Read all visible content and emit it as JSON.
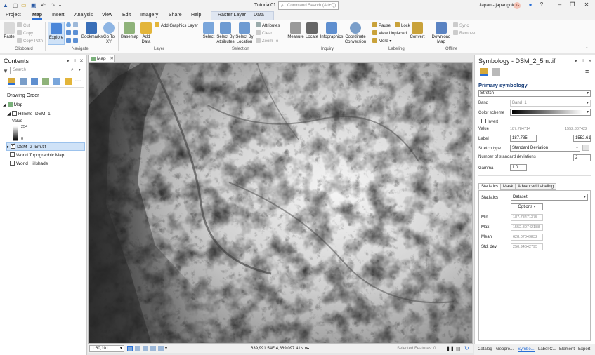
{
  "title_bar": {
    "doc_title": "Tutorial01",
    "search_placeholder": "Command Search (Alt+Q)",
    "account": "Japan - japangold",
    "avatar_initials": "JG",
    "help": "?"
  },
  "tabs": [
    {
      "label": "Project",
      "active": false
    },
    {
      "label": "Map",
      "active": true
    },
    {
      "label": "Insert",
      "active": false
    },
    {
      "label": "Analysis",
      "active": false
    },
    {
      "label": "View",
      "active": false
    },
    {
      "label": "Edit",
      "active": false
    },
    {
      "label": "Imagery",
      "active": false
    },
    {
      "label": "Share",
      "active": false
    },
    {
      "label": "Help",
      "active": false
    },
    {
      "label": "Raster Layer",
      "active": false
    },
    {
      "label": "Data",
      "active": false
    }
  ],
  "ribbon": {
    "paste": "Paste",
    "cut": "Cut",
    "copy": "Copy",
    "copy_path": "Copy Path",
    "clipboard": "Clipboard",
    "explore": "Explore",
    "bookmarks": "Bookmarks",
    "go_to_xy": "Go To XY",
    "navigate": "Navigate",
    "basemap": "Basemap",
    "add_data": "Add Data",
    "add_graphics_layer": "Add Graphics Layer",
    "layer": "Layer",
    "select": "Select",
    "select_by_attributes": "Select By Attributes",
    "select_by_location": "Select By Location",
    "attributes": "Attributes",
    "clear": "Clear",
    "zoom_to": "Zoom To",
    "selection": "Selection",
    "measure": "Measure",
    "locate": "Locate",
    "infographics": "Infographics",
    "coordinate_conversion": "Coordinate Conversion",
    "inquiry": "Inquiry",
    "pause": "Pause",
    "lock": "Lock",
    "view_unplaced": "View Unplaced",
    "more": "More",
    "convert": "Convert",
    "labeling": "Labeling",
    "download_map": "Download Map",
    "sync": "Sync",
    "remove": "Remove",
    "offline": "Offline"
  },
  "contents": {
    "title": "Contents",
    "search_placeholder": "Search",
    "drawing_order": "Drawing Order",
    "map_label": "Map",
    "layers": [
      {
        "name": "HillShe_DSM_1",
        "checked": false
      },
      {
        "name": "DSM_2_5m.tif",
        "checked": true,
        "selected": true
      },
      {
        "name": "World Topographic Map",
        "checked": false
      },
      {
        "name": "World Hillshade",
        "checked": false
      }
    ],
    "legend_title": "Value",
    "legend_high": "254",
    "legend_low": "0"
  },
  "map": {
    "tab_label": "Map",
    "scale": "1:60,101",
    "coordinates": "639,991.54E 4,869,097.41N m",
    "selected_features": "Selected Features: 0"
  },
  "symbology": {
    "title": "Symbology - DSM_2_5m.tif",
    "primary": "Primary symbology",
    "renderer": "Stretch",
    "band_label": "Band",
    "band_value": "Band_1",
    "color_scheme_label": "Color scheme",
    "invert_label": "Invert",
    "value_label": "Value",
    "value_min": "187.784714",
    "value_max": "1552.807422",
    "label_label": "Label",
    "label_min": "187.785",
    "label_max": "1552.61",
    "stretch_type_label": "Stretch type",
    "stretch_type": "Standard Deviation",
    "num_std_label": "Number of standard deviations",
    "num_std": "2",
    "gamma_label": "Gamma",
    "gamma": "1.0",
    "tabs": [
      "Statistics",
      "Mask",
      "Advanced Labeling"
    ],
    "statistics_label": "Statistics",
    "statistics_value": "Dataset",
    "options": "Options",
    "stats": [
      {
        "label": "Min",
        "value": "187.78471375"
      },
      {
        "label": "Max",
        "value": "1552.80742188"
      },
      {
        "label": "Mean",
        "value": "628.07049832"
      },
      {
        "label": "Std. dev",
        "value": "250.94642795"
      }
    ]
  },
  "bottom_tabs": [
    "Catalog",
    "Geopro...",
    "Symbo...",
    "Label C...",
    "Element",
    "Export"
  ]
}
